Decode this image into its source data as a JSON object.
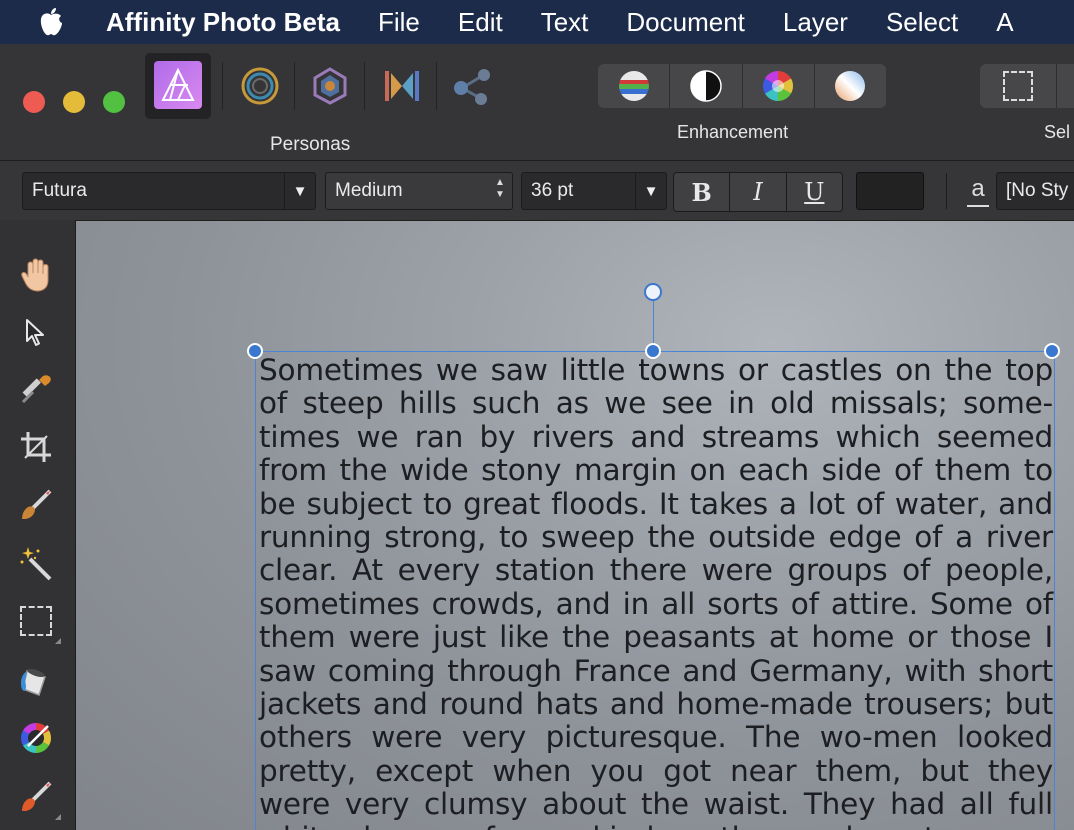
{
  "menubar": {
    "app_name": "Affinity Photo Beta",
    "items": [
      "File",
      "Edit",
      "Text",
      "Document",
      "Layer",
      "Select",
      "A"
    ]
  },
  "toolbar": {
    "personas_label": "Personas",
    "enhancement_label": "Enhancement",
    "select_label": "Sel",
    "persona_icons": [
      "photo-persona-icon",
      "liquify-persona-icon",
      "develop-persona-icon",
      "tone-mapping-persona-icon",
      "export-persona-icon"
    ],
    "enhancement_icons": [
      "levels-icon",
      "brightness-contrast-icon",
      "hsl-icon",
      "white-balance-icon"
    ]
  },
  "context": {
    "font_family": "Futura",
    "font_weight": "Medium",
    "font_size": "36 pt",
    "bold_label": "B",
    "italic_label": "I",
    "underline_label": "U",
    "text_style_icon": "a",
    "text_style": "[No Sty",
    "text_color": "#222222"
  },
  "tools": [
    "view-hand-tool-icon",
    "move-tool-icon",
    "color-picker-tool-icon",
    "crop-tool-icon",
    "selection-brush-tool-icon",
    "magic-wand-tool-icon",
    "rectangular-marquee-tool-icon",
    "flood-fill-tool-icon",
    "gradient-tool-icon",
    "paint-brush-tool-icon"
  ],
  "canvas": {
    "text": "Sometimes we saw little towns or castles on the top of steep hills such as we see in old missals; some-times we ran by rivers and streams which seemed from the wide stony margin on each side of them to be subject to great floods. It takes a lot of water, and running strong, to sweep the outside edge of a river clear. At every station there were groups of people, sometimes crowds, and in all sorts of attire. Some of them were just like the peasants at home or those I saw coming through France and Germany, with short jackets and round hats and home-made trousers; but others were very picturesque. The wo-men looked pretty, except when you got near them, but they were very clumsy about the waist. They had all full white sleeves of some kind or other, and most"
  },
  "colors": {
    "menubar_bg": "#1c2b4a",
    "toolbar_bg": "#353537",
    "selection_accent": "#3a78cf",
    "traffic_close": "#ee5b52",
    "traffic_minimize": "#e5bb3a",
    "traffic_zoom": "#52c041"
  }
}
